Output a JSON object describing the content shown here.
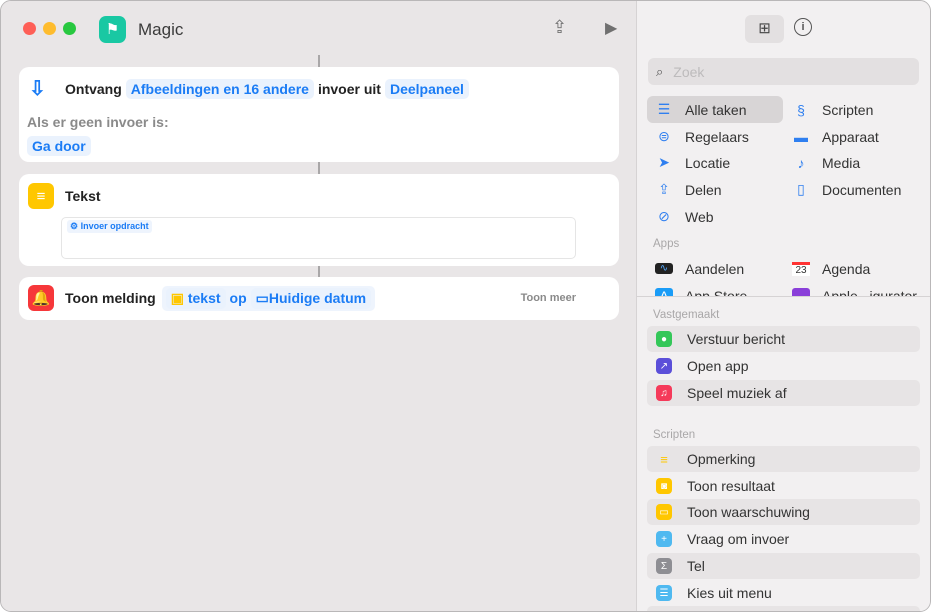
{
  "window": {
    "title": "Magic"
  },
  "colors": {
    "accent": "#1b7cf5",
    "app_icon": "#19c8a3"
  },
  "actions": [
    {
      "verb": "Ontvang",
      "param1": "Afbeeldingen en 16 andere",
      "mid": "invoer uit",
      "param2": "Deelpaneel",
      "no_input_label": "Als er geen invoer is:",
      "no_input_value": "Ga door"
    },
    {
      "title": "Tekst",
      "variable": "Invoer opdracht"
    },
    {
      "title": "Toon melding",
      "param1": "tekst",
      "mid": "op",
      "param2": "Huidige datum",
      "more": "Toon meer"
    }
  ],
  "sidebar": {
    "search_placeholder": "Zoek",
    "categories": [
      "Alle taken",
      "Scripten",
      "Regelaars",
      "Apparaat",
      "Locatie",
      "Media",
      "Delen",
      "Documenten",
      "Web"
    ],
    "apps_label": "Apps",
    "apps": [
      "Aandelen",
      "Agenda",
      "App Store",
      "Apple...igurator"
    ],
    "pinned_label": "Vastgemaakt",
    "pinned": [
      "Verstuur bericht",
      "Open app",
      "Speel muziek af"
    ],
    "scripts_label": "Scripten",
    "scripts": [
      "Opmerking",
      "Toon resultaat",
      "Toon waarschuwing",
      "Vraag om invoer",
      "Tel",
      "Kies uit menu"
    ]
  }
}
